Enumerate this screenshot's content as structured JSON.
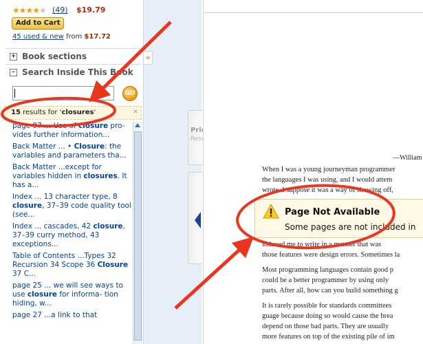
{
  "product": {
    "stars_filled": "★★★★",
    "stars_empty": "★",
    "review_count": "(49)",
    "price": "$19.79",
    "add_to_cart": "Add to Cart",
    "used_new_link": "45 used & new",
    "used_from_text": " from ",
    "used_price": "$17.72"
  },
  "sidebar": {
    "book_sections": "Book sections",
    "search_inside": "Search Inside This Book",
    "expand_symbol": "+",
    "collapse_symbol": "–",
    "search_value": "",
    "go_label": "GO",
    "results_count": "15",
    "results_prefix": " results for '",
    "results_term": "closures",
    "results_suffix": "'",
    "close_symbol": "×",
    "collapse_panel": "«"
  },
  "results": [
    {
      "parts": [
        "page 97 ... Use of ",
        "closure",
        " pro- vides further information..."
      ]
    },
    {
      "parts": [
        "Back Matter ... • ",
        "Closure",
        ": the variables and parameters tha..."
      ]
    },
    {
      "parts": [
        "Back Matter ...except for variables hidden in ",
        "closures",
        ". It has a..."
      ]
    },
    {
      "parts": [
        "Index ... 13 character type, 8 ",
        "closure",
        ", 37–39 code quality tool (see..."
      ]
    },
    {
      "parts": [
        "Index ... cascades, 42 ",
        "closure",
        ", 37–39 curry method, 43 exceptions..."
      ]
    },
    {
      "parts": [
        "Table of Contents ...Types 32 Recursion 34 Scope 36 ",
        "Closure",
        " 37 C..."
      ]
    },
    {
      "parts": [
        "page 25 ... we will see ways to use ",
        "closure",
        " for informa- tion hiding, w..."
      ]
    },
    {
      "parts": [
        "page 27 ...a link to that",
        "",
        ""
      ]
    }
  ],
  "viewer": {
    "prior_label": "Prior",
    "result_label": "Result",
    "attribution": "—William",
    "lines": [
      "When I was a young journeyman programmer",
      "the languages I was using, and I would attem",
      "wrote. I suppose it was a way of showing off,",
      "induced me to write in a manner that was",
      "those features were design errors. Sometimes la",
      "Most programming languages contain good p",
      "could be a better programmer by using only",
      "parts. After all, how can you build something g",
      "It is rarely possible for standards committees",
      "guage because doing so would cause the brea",
      "depend on those bad parts. They are usually",
      "more features on top of the existing pile of im"
    ],
    "not_available_title": "Page Not Available",
    "not_available_msg": "Some pages are not included in"
  },
  "colors": {
    "annotation": "#e8361f",
    "link": "#00429a",
    "price": "#b12704",
    "panel": "#e6eff7"
  }
}
